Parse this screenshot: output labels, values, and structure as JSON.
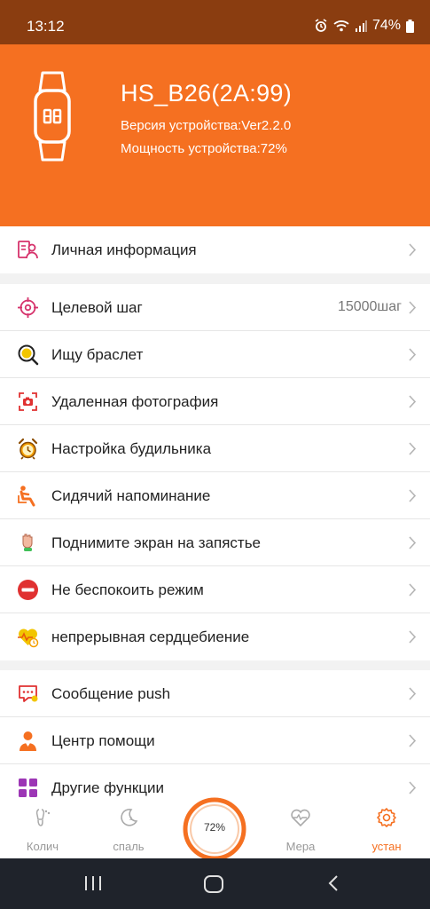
{
  "status": {
    "time": "13:12",
    "battery": "74%"
  },
  "device": {
    "name": "HS_B26(2A:99)",
    "version": "Версия устройства:Ver2.2.0",
    "power": "Мощность устройства:72%"
  },
  "groups": [
    {
      "items": [
        {
          "label": "Личная информация",
          "icon": "profile-icon"
        }
      ]
    },
    {
      "items": [
        {
          "label": "Целевой шаг",
          "value": "15000шаг",
          "icon": "target-icon"
        },
        {
          "label": "Ищу браслет",
          "icon": "search-bracelet-icon"
        },
        {
          "label": "Удаленная фотография",
          "icon": "camera-icon"
        },
        {
          "label": "Настройка будильника",
          "icon": "alarm-clock-icon"
        },
        {
          "label": "Сидячий напоминание",
          "icon": "sitting-person-icon"
        },
        {
          "label": "Поднимите экран на запястье",
          "icon": "raise-wrist-icon"
        },
        {
          "label": "Не беспокоить режим",
          "icon": "do-not-disturb-icon"
        },
        {
          "label": "непрерывная сердцебиение",
          "icon": "heart-rate-icon"
        }
      ]
    },
    {
      "items": [
        {
          "label": "Сообщение push",
          "icon": "message-icon"
        },
        {
          "label": "Центр помощи",
          "icon": "help-person-icon"
        },
        {
          "label": "Другие функции",
          "icon": "grid-apps-icon"
        }
      ]
    }
  ],
  "nav": {
    "items": [
      {
        "label": "Колич",
        "icon": "steps-icon"
      },
      {
        "label": "спаль",
        "icon": "moon-icon"
      },
      {
        "label": "Мера",
        "icon": "heart-measure-icon"
      },
      {
        "label": "устан",
        "icon": "gear-icon",
        "active": true
      }
    ],
    "center_label": "72%",
    "center_progress": 0.72
  },
  "colors": {
    "accent": "#f57021",
    "status_bar": "#8a3d10",
    "system_nav": "#1f232b"
  }
}
